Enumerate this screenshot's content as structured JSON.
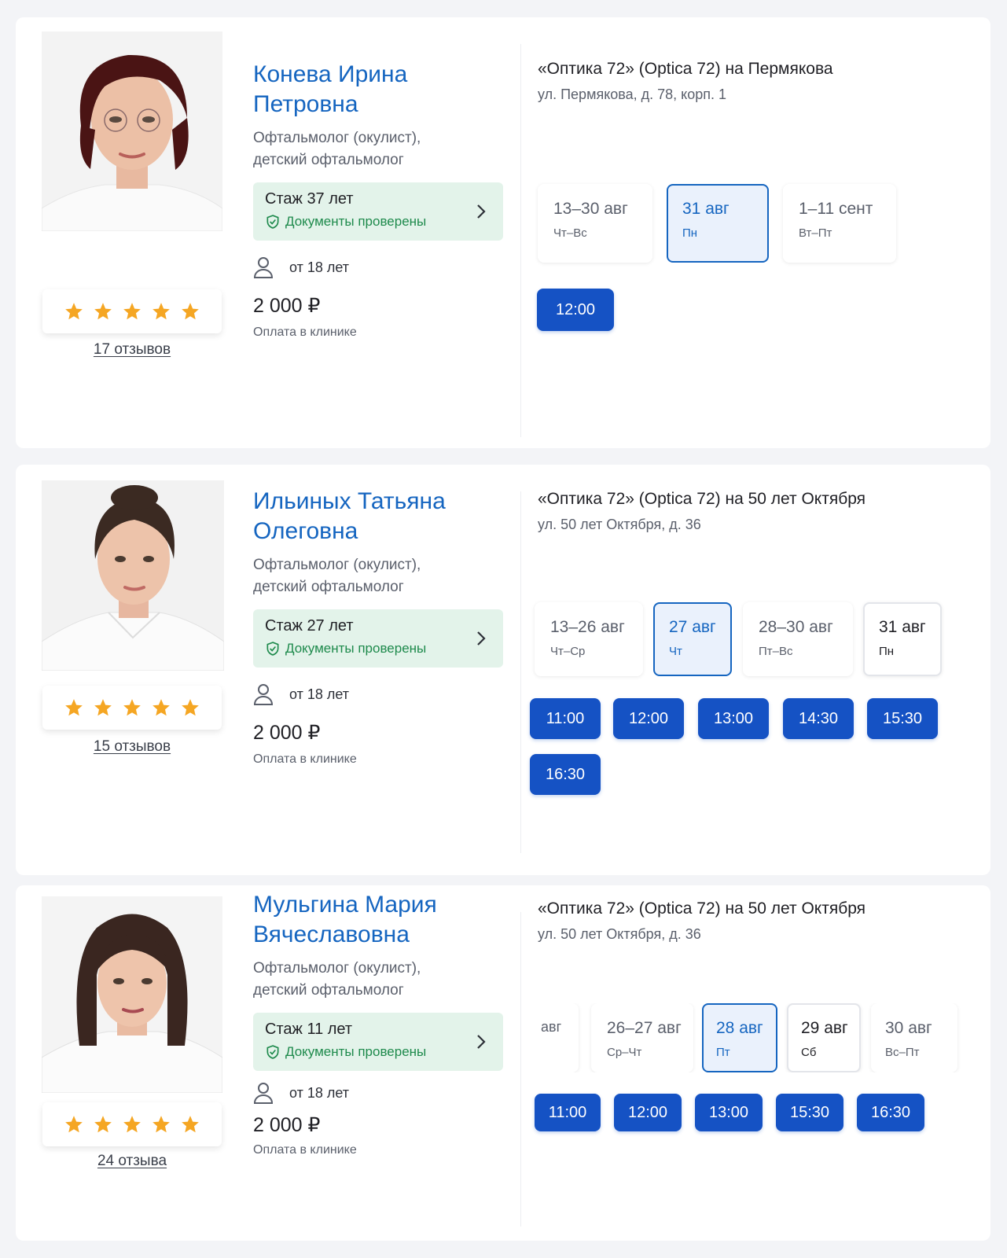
{
  "doctors": [
    {
      "name": "Конева Ирина Петровна",
      "specialty": "Офтальмолог (окулист), детский офтальмолог",
      "experience": "Стаж 37 лет",
      "docs_verified": "Документы проверены",
      "age_limit": "от 18 лет",
      "price": "2 000 ₽",
      "payment_note": "Оплата в клинике",
      "rating_stars": 5,
      "reviews": "17 отзывов",
      "clinic_name": "«Оптика 72» (Optica 72) на Пермякова",
      "clinic_address": "ул. Пермякова, д. 78, корп. 1",
      "dates": [
        {
          "label": "13–30 авг",
          "sub": "Чт–Вс",
          "state": "normal"
        },
        {
          "label": "31 авг",
          "sub": "Пн",
          "state": "selected"
        },
        {
          "label": "1–11 сент",
          "sub": "Вт–Пт",
          "state": "normal"
        }
      ],
      "slots": [
        "12:00"
      ]
    },
    {
      "name": "Ильиных Татьяна Олеговна",
      "specialty": "Офтальмолог (окулист), детский офтальмолог",
      "experience": "Стаж 27 лет",
      "docs_verified": "Документы проверены",
      "age_limit": "от 18 лет",
      "price": "2 000 ₽",
      "payment_note": "Оплата в клинике",
      "rating_stars": 5,
      "reviews": "15 отзывов",
      "clinic_name": "«Оптика 72» (Optica 72) на 50 лет Октября",
      "clinic_address": "ул. 50 лет Октября, д. 36",
      "dates": [
        {
          "label": "13–26 авг",
          "sub": "Чт–Ср",
          "state": "normal"
        },
        {
          "label": "27 авг",
          "sub": "Чт",
          "state": "selected"
        },
        {
          "label": "28–30 авг",
          "sub": "Пт–Вс",
          "state": "normal"
        },
        {
          "label": "31 авг",
          "sub": "Пн",
          "state": "available"
        }
      ],
      "slots": [
        "11:00",
        "12:00",
        "13:00",
        "14:30",
        "15:30",
        "16:30"
      ]
    },
    {
      "name": "Мульгина Мария Вячеславовна",
      "specialty": "Офтальмолог (окулист), детский офтальмолог",
      "experience": "Стаж 11 лет",
      "docs_verified": "Документы проверены",
      "age_limit": "от 18 лет",
      "price": "2 000 ₽",
      "payment_note": "Оплата в клинике",
      "rating_stars": 5,
      "reviews": "24 отзыва",
      "clinic_name": "«Оптика 72» (Optica 72) на 50 лет Октября",
      "clinic_address": "ул. 50 лет Октября, д. 36",
      "dates": [
        {
          "label": "авг",
          "sub": "",
          "state": "normal"
        },
        {
          "label": "26–27 авг",
          "sub": "Ср–Чт",
          "state": "normal"
        },
        {
          "label": "28 авг",
          "sub": "Пт",
          "state": "selected"
        },
        {
          "label": "29 авг",
          "sub": "Сб",
          "state": "available",
          "sub_weekend": true
        },
        {
          "label": "30 авг",
          "sub": "Вс–Пт",
          "state": "normal"
        }
      ],
      "slots": [
        "11:00",
        "12:00",
        "13:00",
        "15:30",
        "16:30"
      ]
    }
  ],
  "colors": {
    "accent": "#1565c0",
    "slot_bg": "#1552c4",
    "verified_green": "#1e8a4c",
    "verified_bg": "#e3f3ea",
    "star": "#f5a623",
    "weekend_red": "#d03131"
  },
  "icons": {
    "star": "star-icon",
    "shield": "shield-check-icon",
    "chevron": "chevron-right-icon",
    "person": "person-icon"
  }
}
